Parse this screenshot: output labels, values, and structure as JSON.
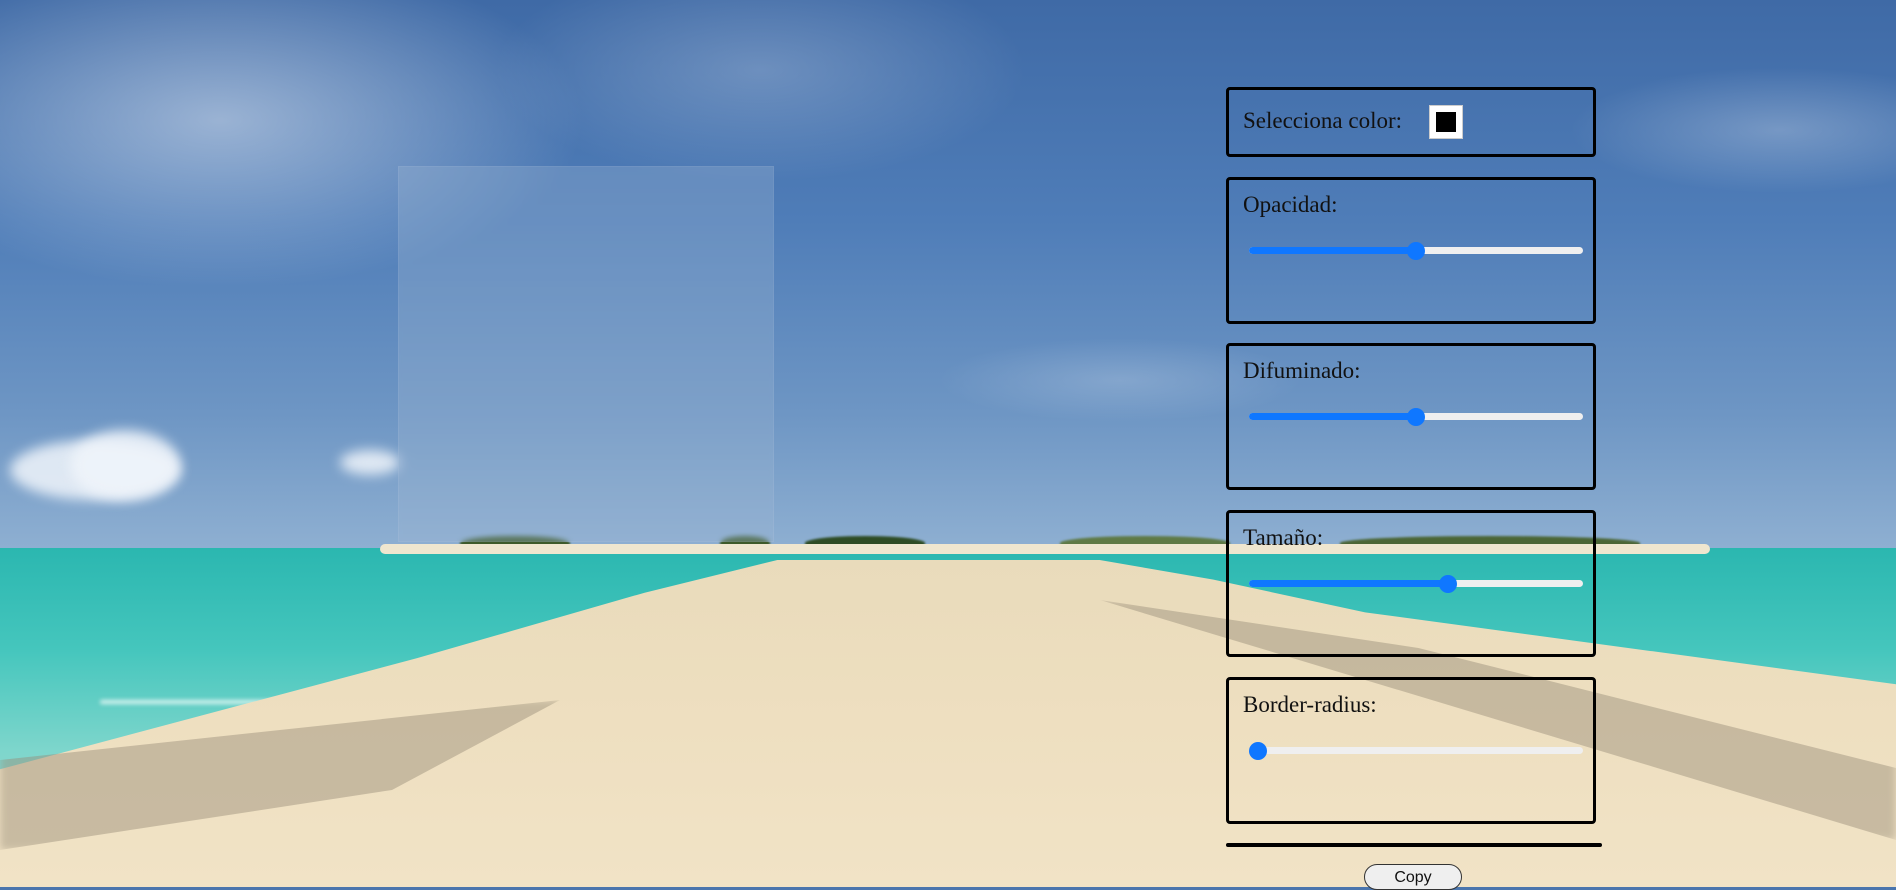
{
  "controls": {
    "color": {
      "label": "Selecciona color:",
      "value": "#000000"
    },
    "opacity": {
      "label": "Opacidad:",
      "value": 0.5
    },
    "blur": {
      "label": "Difuminado:",
      "value": 0.5
    },
    "size": {
      "label": "Tamaño:",
      "value": 0.6
    },
    "radius": {
      "label": "Border-radius:",
      "value": 0.0
    }
  },
  "copy_button": {
    "label": "Copy"
  },
  "colors": {
    "slider_accent": "#0f77ff",
    "panel_border": "#000000"
  }
}
